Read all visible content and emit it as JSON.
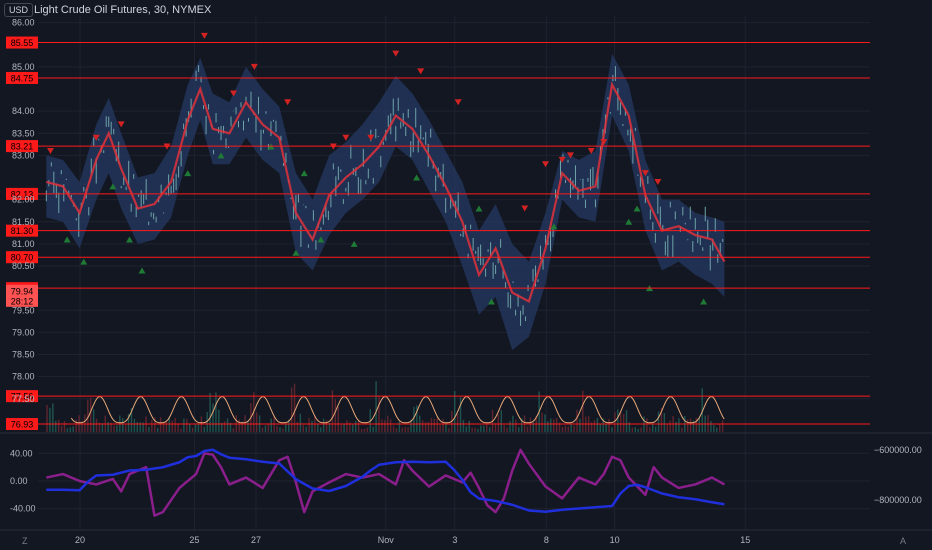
{
  "header": {
    "currency": "USD",
    "title": "Light Crude Oil Futures, 30, NYMEX"
  },
  "corner": {
    "left": "Z",
    "right": "A"
  },
  "colors": {
    "background": "#131722",
    "grid": "#1f2330",
    "axis_text": "#b2b5be",
    "level_line": "#ff1a1a",
    "level_label_bg": "#ff1a1a",
    "current_price_bg": "#ff5252",
    "price_candles": "#6fa3a8",
    "moving_average": "#e0313b",
    "band_fill": "#243a63",
    "buy_marker": "#1f7a35",
    "sell_marker": "#d32222",
    "volume_up": "#246a5e",
    "volume_down": "#7a2b33",
    "volume_osc": "#e8a878",
    "indicator_purple": "#8a1f8c",
    "indicator_blue": "#1f2fdc"
  },
  "chart_data": [
    {
      "type": "line",
      "panel": "price",
      "title": "Light Crude Oil Futures, 30, NYMEX",
      "x_ticks": [
        "20",
        "25",
        "27",
        "Nov",
        "3",
        "8",
        "10",
        "15"
      ],
      "x_tick_pos": [
        0.05,
        13.8,
        21.2,
        36.8,
        45.1,
        56.1,
        64.3,
        80.0
      ],
      "x_range": [
        -5,
        95
      ],
      "y_ticks": [
        86.0,
        85.0,
        84.0,
        83.5,
        83.0,
        82.0,
        81.5,
        81.0,
        80.5,
        79.5,
        79.0,
        78.5,
        78.0,
        77.5
      ],
      "y_tick_labels": [
        "86.00",
        "85.00",
        "84.00",
        "83.50",
        "83.00",
        "82.00",
        "81.50",
        "81.00",
        "80.50",
        "79.50",
        "79.00",
        "78.50",
        "78.00",
        "77.50"
      ],
      "ylim": [
        76.75,
        86.15
      ],
      "levels": [
        {
          "value": 85.55,
          "label": "85.55"
        },
        {
          "value": 84.75,
          "label": "84.75"
        },
        {
          "value": 83.21,
          "label": "83.21"
        },
        {
          "value": 82.13,
          "label": "82.13"
        },
        {
          "value": 81.3,
          "label": "81.30"
        },
        {
          "value": 80.7,
          "label": "80.70"
        },
        {
          "value": 80.0,
          "label": "80.00"
        },
        {
          "value": 77.56,
          "label": "77.56"
        },
        {
          "value": 76.93,
          "label": "76.93"
        }
      ],
      "current_price": {
        "value": 79.94,
        "label": "79.94",
        "countdown": "28:12"
      },
      "series": [
        {
          "role": "moving_average",
          "x": [
            -4,
            -2,
            0,
            2,
            3.5,
            5,
            7,
            9,
            11,
            13,
            14.5,
            16,
            18,
            20,
            22,
            24,
            26,
            28,
            30,
            32,
            34,
            36,
            38,
            40,
            42,
            44,
            46,
            48,
            50,
            52,
            54,
            56,
            58,
            60,
            62,
            64,
            66,
            68,
            70,
            72,
            74,
            76,
            77.5
          ],
          "values": [
            82.4,
            82.3,
            81.7,
            82.9,
            83.5,
            82.7,
            81.8,
            81.9,
            82.4,
            83.8,
            84.5,
            83.6,
            83.5,
            84.2,
            83.7,
            83.4,
            81.7,
            81.1,
            82.1,
            82.5,
            82.8,
            83.2,
            83.9,
            83.6,
            83.0,
            82.3,
            81.5,
            80.3,
            80.9,
            79.9,
            79.7,
            80.9,
            82.6,
            82.2,
            82.3,
            84.6,
            83.9,
            82.1,
            81.3,
            81.4,
            81.2,
            81.1,
            80.6
          ]
        },
        {
          "role": "band_upper",
          "x": [
            -4,
            -2,
            0,
            2,
            3.5,
            5,
            7,
            9,
            11,
            13,
            14.5,
            16,
            18,
            20,
            22,
            24,
            26,
            28,
            30,
            32,
            34,
            36,
            38,
            40,
            42,
            44,
            46,
            48,
            50,
            52,
            54,
            56,
            58,
            60,
            62,
            64,
            66,
            68,
            70,
            72,
            74,
            76,
            77.5
          ],
          "values": [
            83.0,
            82.9,
            82.4,
            83.7,
            84.3,
            83.5,
            82.5,
            82.6,
            83.2,
            84.6,
            85.2,
            84.4,
            84.2,
            85.0,
            84.5,
            84.1,
            82.6,
            82.0,
            83.0,
            83.3,
            83.7,
            84.2,
            84.8,
            84.4,
            83.8,
            83.1,
            82.4,
            81.3,
            81.9,
            81.0,
            80.6,
            81.7,
            83.1,
            82.9,
            83.1,
            85.3,
            84.6,
            82.9,
            82.0,
            82.0,
            81.7,
            81.6,
            81.5
          ]
        },
        {
          "role": "band_lower",
          "x": [
            -4,
            -2,
            0,
            2,
            3.5,
            5,
            7,
            9,
            11,
            13,
            14.5,
            16,
            18,
            20,
            22,
            24,
            26,
            28,
            30,
            32,
            34,
            36,
            38,
            40,
            42,
            44,
            46,
            48,
            50,
            52,
            54,
            56,
            58,
            60,
            62,
            64,
            66,
            68,
            70,
            72,
            74,
            76,
            77.5
          ],
          "values": [
            81.6,
            81.5,
            80.9,
            82.0,
            82.6,
            81.8,
            81.0,
            81.1,
            81.6,
            83.0,
            83.8,
            82.8,
            82.8,
            83.4,
            82.9,
            82.6,
            80.8,
            80.4,
            81.2,
            81.7,
            82.0,
            82.4,
            83.2,
            82.9,
            82.2,
            81.5,
            80.5,
            79.4,
            79.8,
            78.6,
            78.9,
            80.1,
            82.0,
            81.6,
            81.5,
            83.9,
            83.1,
            81.3,
            80.4,
            80.6,
            80.3,
            80.1,
            79.8
          ]
        }
      ],
      "sell_markers": [
        {
          "x": -3.5,
          "y": 83.1
        },
        {
          "x": 2,
          "y": 83.4
        },
        {
          "x": 5,
          "y": 83.7
        },
        {
          "x": 10.5,
          "y": 83.2
        },
        {
          "x": 15,
          "y": 85.7
        },
        {
          "x": 18.5,
          "y": 84.4
        },
        {
          "x": 21,
          "y": 85.0
        },
        {
          "x": 25,
          "y": 84.2
        },
        {
          "x": 30.5,
          "y": 83.2
        },
        {
          "x": 32,
          "y": 83.4
        },
        {
          "x": 35,
          "y": 83.4
        },
        {
          "x": 38,
          "y": 85.3
        },
        {
          "x": 41,
          "y": 84.9
        },
        {
          "x": 45.5,
          "y": 84.2
        },
        {
          "x": 56,
          "y": 82.8
        },
        {
          "x": 58,
          "y": 82.9
        },
        {
          "x": 59,
          "y": 83.0
        },
        {
          "x": 61.5,
          "y": 83.1
        },
        {
          "x": 63,
          "y": 83.3
        },
        {
          "x": 68,
          "y": 82.6
        },
        {
          "x": 69.5,
          "y": 82.4
        },
        {
          "x": 53.5,
          "y": 81.8
        }
      ],
      "buy_markers": [
        {
          "x": -1.5,
          "y": 81.1
        },
        {
          "x": 0.5,
          "y": 80.6
        },
        {
          "x": 4,
          "y": 82.3
        },
        {
          "x": 6,
          "y": 81.1
        },
        {
          "x": 7.5,
          "y": 80.4
        },
        {
          "x": 13,
          "y": 82.6
        },
        {
          "x": 17,
          "y": 83.0
        },
        {
          "x": 23,
          "y": 83.2
        },
        {
          "x": 27,
          "y": 82.6
        },
        {
          "x": 26,
          "y": 80.8
        },
        {
          "x": 29,
          "y": 81.1
        },
        {
          "x": 33,
          "y": 81.0
        },
        {
          "x": 40.5,
          "y": 82.5
        },
        {
          "x": 48,
          "y": 81.8
        },
        {
          "x": 49.5,
          "y": 79.7
        },
        {
          "x": 57,
          "y": 81.4
        },
        {
          "x": 66,
          "y": 81.5
        },
        {
          "x": 67,
          "y": 81.8
        },
        {
          "x": 68.5,
          "y": 80.0
        },
        {
          "x": 75,
          "y": 79.7
        }
      ]
    },
    {
      "type": "bar",
      "panel": "volume",
      "series": [
        {
          "role": "volume_oscillator",
          "period": 4.9,
          "low": 76.96,
          "high": 77.55
        }
      ]
    },
    {
      "type": "line",
      "panel": "indicator",
      "y_ticks_left": [
        40.0,
        0.0,
        -40.0
      ],
      "y_tick_labels_left": [
        "40.00",
        "0.00",
        "-40.00"
      ],
      "ylim_left": [
        -65,
        65
      ],
      "y_ticks_right": [
        -600000,
        -800000
      ],
      "y_tick_labels_right": [
        "−600000.00",
        "−800000.00"
      ],
      "ylim_right": [
        -905000,
        -545000
      ],
      "series": [
        {
          "role": "purple_oscillator",
          "x": [
            -4,
            -2,
            0,
            2,
            4,
            5,
            6,
            8,
            9,
            10,
            12,
            14,
            15,
            16,
            17,
            18,
            20,
            22,
            24,
            25,
            26,
            27,
            28,
            30,
            32,
            34,
            36,
            38,
            39,
            40,
            42,
            44,
            46,
            47,
            48,
            49,
            50,
            51,
            52,
            53,
            54,
            56,
            58,
            60,
            62,
            63,
            64,
            65,
            66,
            68,
            69,
            70,
            72,
            74,
            76,
            77.5
          ],
          "values": [
            5,
            10,
            0,
            -5,
            3,
            -15,
            10,
            20,
            -50,
            -45,
            -10,
            10,
            40,
            38,
            20,
            -5,
            5,
            -10,
            30,
            35,
            -2,
            -45,
            -15,
            -2,
            10,
            5,
            10,
            -5,
            30,
            15,
            -8,
            8,
            -2,
            12,
            -10,
            -35,
            -45,
            -25,
            15,
            45,
            25,
            -8,
            -25,
            5,
            -5,
            10,
            35,
            30,
            5,
            -20,
            20,
            5,
            -10,
            -5,
            5,
            -5
          ]
        },
        {
          "role": "blue_cumulative",
          "x": [
            -4,
            -2,
            0,
            1,
            2,
            4,
            6,
            8,
            10,
            12,
            13,
            14,
            15,
            16,
            17,
            18,
            20,
            22,
            24,
            26,
            28,
            30,
            32,
            34,
            35,
            36,
            38,
            40,
            42,
            44,
            45,
            46,
            47,
            48,
            50,
            52,
            54,
            56,
            58,
            60,
            62,
            64,
            65,
            66,
            67,
            68,
            70,
            72,
            74,
            76,
            77.5
          ],
          "values": [
            -760000,
            -760000,
            -762000,
            -728000,
            -703000,
            -700000,
            -683000,
            -680000,
            -670000,
            -650000,
            -630000,
            -625000,
            -605000,
            -600000,
            -618000,
            -632000,
            -638000,
            -648000,
            -655000,
            -718000,
            -755000,
            -765000,
            -745000,
            -708000,
            -682000,
            -660000,
            -650000,
            -648000,
            -650000,
            -648000,
            -680000,
            -720000,
            -770000,
            -795000,
            -805000,
            -820000,
            -843000,
            -848000,
            -840000,
            -835000,
            -830000,
            -825000,
            -775000,
            -745000,
            -740000,
            -750000,
            -775000,
            -790000,
            -798000,
            -810000,
            -818000
          ]
        }
      ]
    }
  ]
}
